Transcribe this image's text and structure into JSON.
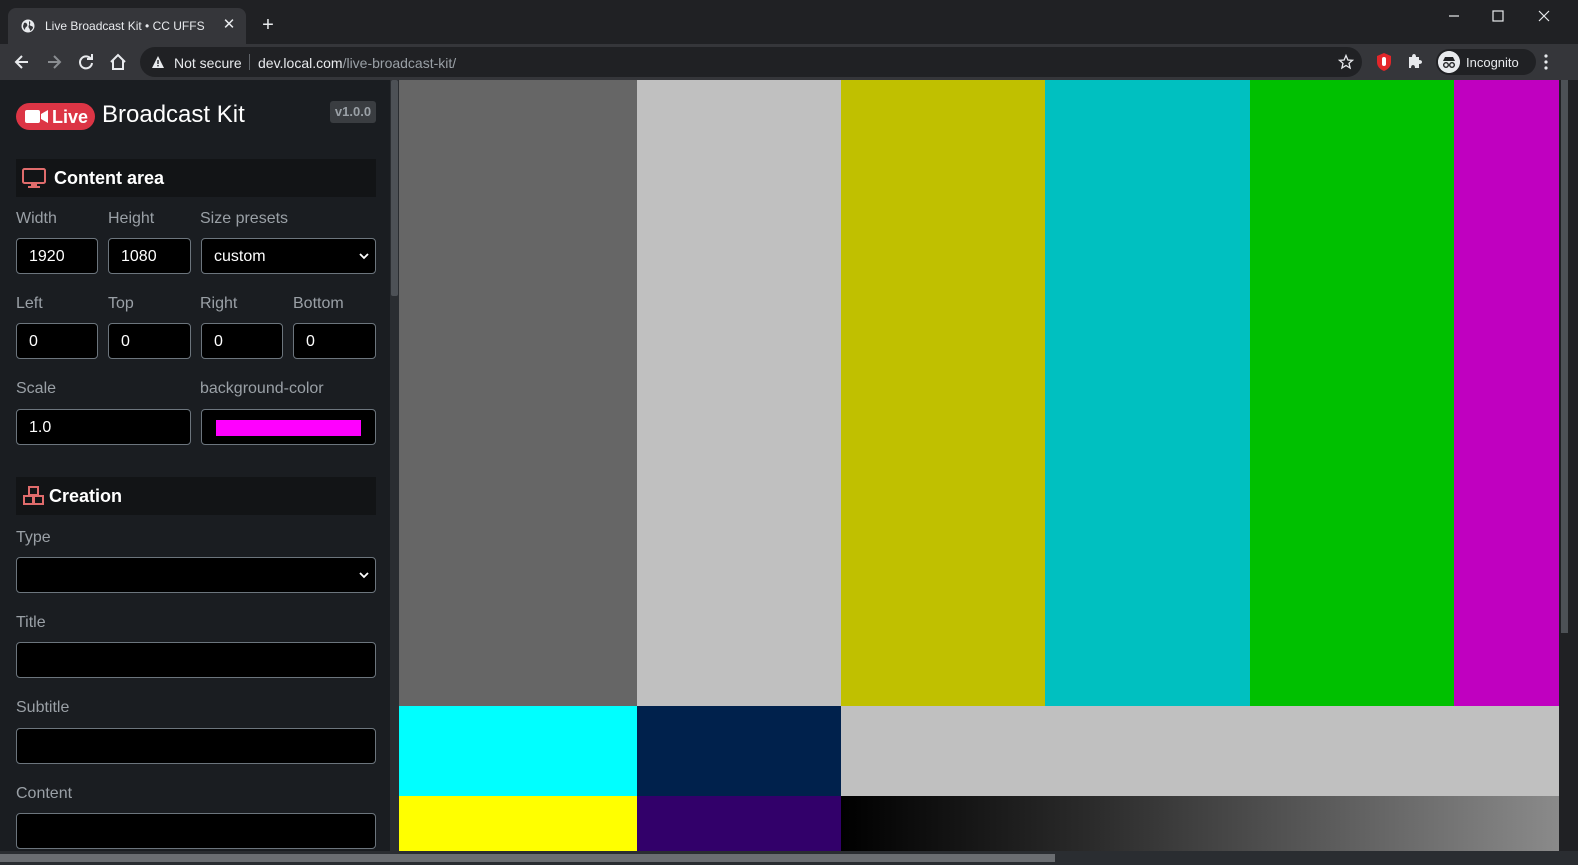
{
  "browser": {
    "tab_title": "Live Broadcast Kit • CC UFFS",
    "close_glyph": "✕",
    "newtab_glyph": "+",
    "security_label": "Not secure",
    "url_host": "dev.local.com",
    "url_path": "/live-broadcast-kit/",
    "profile_label": "Incognito"
  },
  "app": {
    "brand_badge": "Live",
    "brand_title": "Broadcast Kit",
    "version": "v1.0.0"
  },
  "content_area": {
    "heading": "Content area",
    "width_label": "Width",
    "width_value": "1920",
    "height_label": "Height",
    "height_value": "1080",
    "presets_label": "Size presets",
    "presets_value": "custom",
    "left_label": "Left",
    "left_value": "0",
    "top_label": "Top",
    "top_value": "0",
    "right_label": "Right",
    "right_value": "0",
    "bottom_label": "Bottom",
    "bottom_value": "0",
    "scale_label": "Scale",
    "scale_value": "1.0",
    "bgcolor_label": "background-color",
    "bgcolor_value": "#ff00ff"
  },
  "creation": {
    "heading": "Creation",
    "type_label": "Type",
    "type_value": "",
    "title_label": "Title",
    "title_value": "",
    "subtitle_label": "Subtitle",
    "subtitle_value": "",
    "content_label": "Content",
    "content_value": ""
  },
  "colors": {
    "accent": "#dc3545",
    "bars_top": [
      "#666666",
      "#c0c0c0",
      "#c0c000",
      "#00c0c0",
      "#00c000",
      "#c000c0"
    ],
    "bars_middle": [
      "#00ffff",
      "#00214c",
      "#c0c0c0"
    ],
    "bars_bottom": [
      "#ffff00",
      "#32006a"
    ]
  }
}
